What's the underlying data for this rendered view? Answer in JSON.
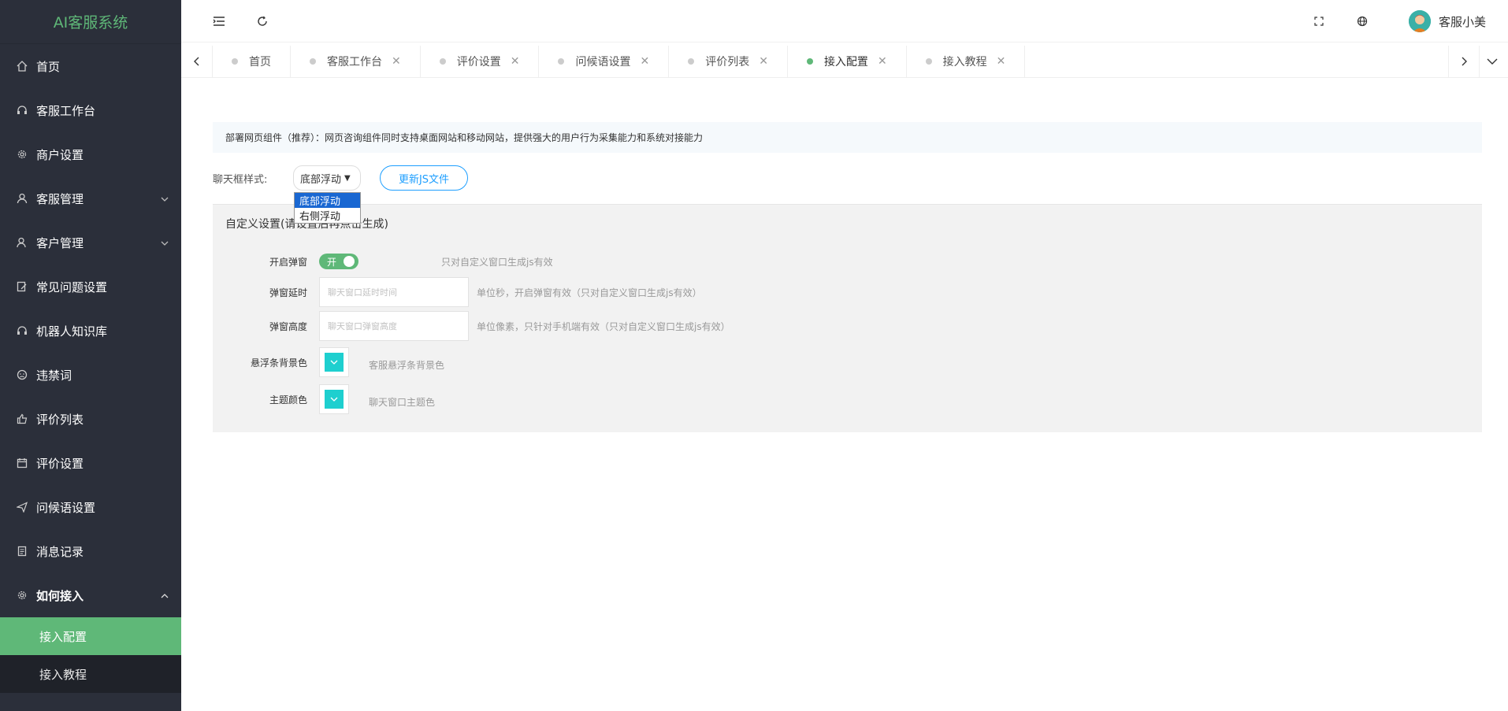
{
  "app": {
    "title": "AI客服系统"
  },
  "sidebar": {
    "items": [
      {
        "label": "首页",
        "icon": "home-icon"
      },
      {
        "label": "客服工作台",
        "icon": "headset-icon"
      },
      {
        "label": "商户设置",
        "icon": "gear-icon"
      },
      {
        "label": "客服管理",
        "icon": "user-icon"
      },
      {
        "label": "客户管理",
        "icon": "users-icon"
      },
      {
        "label": "常见问题设置",
        "icon": "edit-icon"
      },
      {
        "label": "机器人知识库",
        "icon": "robot-icon"
      },
      {
        "label": "违禁词",
        "icon": "face-icon"
      },
      {
        "label": "评价列表",
        "icon": "thumb-icon"
      },
      {
        "label": "评价设置",
        "icon": "calendar-icon"
      },
      {
        "label": "问候语设置",
        "icon": "send-icon"
      },
      {
        "label": "消息记录",
        "icon": "doc-icon"
      },
      {
        "label": "如何接入",
        "icon": "plug-icon"
      }
    ],
    "sub_items": [
      {
        "label": "接入配置"
      },
      {
        "label": "接入教程"
      }
    ]
  },
  "header": {
    "username": "客服小美"
  },
  "tabs": [
    {
      "label": "首页"
    },
    {
      "label": "客服工作台"
    },
    {
      "label": "评价设置"
    },
    {
      "label": "问候语设置"
    },
    {
      "label": "评价列表"
    },
    {
      "label": "接入配置"
    },
    {
      "label": "接入教程"
    }
  ],
  "content": {
    "notice": "部署网页组件（推荐）：网页咨询组件同时支持桌面网站和移动网站，提供强大的用户行为采集能力和系统对接能力",
    "style_label": "聊天框样式:",
    "style_value": "底部浮动",
    "update_button": "更新JS文件",
    "dropdown_options": [
      "底部浮动",
      "右侧浮动"
    ],
    "panel_title": "自定义设置(请设置后再点击生成)",
    "fields": {
      "popup_label": "开启弹窗",
      "popup_switch": "开",
      "popup_hint": "只对自定义窗口生成js有效",
      "delay_label": "弹窗延时",
      "delay_placeholder": "聊天窗口延时时间",
      "delay_hint": "单位秒，开启弹窗有效（只对自定义窗口生成js有效）",
      "height_label": "弹窗高度",
      "height_placeholder": "聊天窗口弹窗高度",
      "height_hint": "单位像素，只针对手机端有效（只对自定义窗口生成js有效）",
      "bar_color_label": "悬浮条背景色",
      "bar_color_hint": "客服悬浮条背景色",
      "theme_color_label": "主题颜色",
      "theme_color_hint": "聊天窗口主题色"
    },
    "colors": {
      "accent": "#5fb878",
      "swatch": "#1ecfcf",
      "link": "#1e9fff"
    }
  }
}
